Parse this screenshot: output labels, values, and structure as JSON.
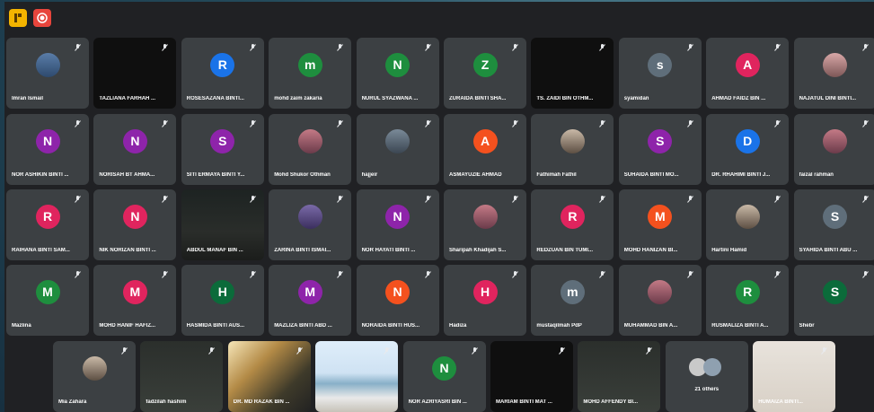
{
  "colors": {
    "red": "#e0245e",
    "green": "#1e8e3e",
    "purple": "#8e24aa",
    "blue": "#1a73e8",
    "orange": "#f4511e",
    "teal": "#5f6368",
    "darkgreen": "#0b6b3a",
    "slate": "#5f6e7a"
  },
  "toolbar": {
    "left_icon": "layout-icon",
    "right_icon": "record-icon"
  },
  "rows": [
    [
      {
        "name": "Imran Ismail",
        "type": "photo"
      },
      {
        "name": "TAZLIANA FARHAH ...",
        "type": "dark"
      },
      {
        "name": "ROSESAZANA BINTI...",
        "type": "avatar",
        "initial": "R",
        "color": "#1a73e8"
      },
      {
        "name": "mohd zaim zakaria",
        "type": "avatar",
        "initial": "m",
        "color": "#1e8e3e"
      },
      {
        "name": "NURUL SYAZWANA ...",
        "type": "avatar",
        "initial": "N",
        "color": "#1e8e3e"
      },
      {
        "name": "ZURAIDA BINTI SHA...",
        "type": "avatar",
        "initial": "Z",
        "color": "#1e8e3e"
      },
      {
        "name": "TS. ZAIDI BIN OTHM...",
        "type": "dark"
      },
      {
        "name": "syamidan",
        "type": "avatar",
        "initial": "s",
        "color": "#5f6e7a"
      },
      {
        "name": "AHMAD FAIDZ BIN ...",
        "type": "avatar",
        "initial": "A",
        "color": "#e0245e"
      },
      {
        "name": "NAJATUL DINI BINTI...",
        "type": "photo"
      }
    ],
    [
      {
        "name": "NOR ASHIKIN BINTI ...",
        "type": "avatar",
        "initial": "N",
        "color": "#8e24aa"
      },
      {
        "name": "NORISAH BT AHMA...",
        "type": "avatar",
        "initial": "N",
        "color": "#8e24aa"
      },
      {
        "name": "SITI ERMAYA BINTI Y...",
        "type": "avatar",
        "initial": "S",
        "color": "#8e24aa"
      },
      {
        "name": "Mohd Shukor Othman",
        "type": "photo"
      },
      {
        "name": "hajjeir",
        "type": "photo"
      },
      {
        "name": "ASMAYUZIE AHMAD",
        "type": "avatar",
        "initial": "A",
        "color": "#f4511e"
      },
      {
        "name": "Fathimah Fathil",
        "type": "photo"
      },
      {
        "name": "SUHAIDA BINTI MO...",
        "type": "avatar",
        "initial": "S",
        "color": "#8e24aa"
      },
      {
        "name": "DR. RHAHIMI BINTI J...",
        "type": "avatar",
        "initial": "D",
        "color": "#1a73e8"
      },
      {
        "name": "faizal rahman",
        "type": "photo"
      }
    ],
    [
      {
        "name": "RAIHANA BINTI SAM...",
        "type": "avatar",
        "initial": "R",
        "color": "#e0245e"
      },
      {
        "name": "NIK NORIZAN BINTI ...",
        "type": "avatar",
        "initial": "N",
        "color": "#e0245e"
      },
      {
        "name": "ABDUL MANAF BIN ...",
        "type": "video1"
      },
      {
        "name": "ZARINA BINTI ISMAI...",
        "type": "photo"
      },
      {
        "name": "NOR HAYATI BINTI ...",
        "type": "avatar",
        "initial": "N",
        "color": "#8e24aa"
      },
      {
        "name": "Sharipah Khadijah S...",
        "type": "photo"
      },
      {
        "name": "REDZUAN BIN TUMI...",
        "type": "avatar",
        "initial": "R",
        "color": "#e0245e"
      },
      {
        "name": "MOHD HANIZAN BI...",
        "type": "avatar",
        "initial": "M",
        "color": "#f4511e"
      },
      {
        "name": "Hartini Hamid",
        "type": "photo"
      },
      {
        "name": "SYAHIDA BINTI ABU ...",
        "type": "avatar",
        "initial": "S",
        "color": "#5f6e7a"
      }
    ],
    [
      {
        "name": "Mazlina",
        "type": "avatar",
        "initial": "M",
        "color": "#1e8e3e"
      },
      {
        "name": "MOHD HANIF HAFIZ...",
        "type": "avatar",
        "initial": "M",
        "color": "#e0245e"
      },
      {
        "name": "HASMIDA BINTI AUS...",
        "type": "avatar",
        "initial": "H",
        "color": "#0b6b3a"
      },
      {
        "name": "MAZLIZA BINTI ABD ...",
        "type": "avatar",
        "initial": "M",
        "color": "#8e24aa"
      },
      {
        "name": "NORAIDA BINTI HUS...",
        "type": "avatar",
        "initial": "N",
        "color": "#f4511e"
      },
      {
        "name": "Hadiza",
        "type": "avatar",
        "initial": "H",
        "color": "#e0245e"
      },
      {
        "name": "mustaqilmah PdP",
        "type": "avatar",
        "initial": "m",
        "color": "#5f6e7a"
      },
      {
        "name": "MUHAMMAD BIN A...",
        "type": "photo"
      },
      {
        "name": "RUSMALIZA BINTI A...",
        "type": "avatar",
        "initial": "R",
        "color": "#1e8e3e"
      },
      {
        "name": "Shebr",
        "type": "avatar",
        "initial": "S",
        "color": "#0b6b3a"
      }
    ],
    [
      {
        "name": "Mia Zahara",
        "type": "photo"
      },
      {
        "name": "fadzilah hashim",
        "type": "video5"
      },
      {
        "name": "DR. MD RAZAK BIN ...",
        "type": "video2"
      },
      {
        "name": "",
        "type": "video3"
      },
      {
        "name": "NOR AZRIYASRI BIN ...",
        "type": "avatar",
        "initial": "N",
        "color": "#1e8e3e"
      },
      {
        "name": "MARIAM BINTI MAT ...",
        "type": "dark"
      },
      {
        "name": "MOHD AFFENDY BI...",
        "type": "video5"
      },
      {
        "name": "21 others",
        "type": "others"
      },
      {
        "name": "HUMAIZA BINTI...",
        "type": "video4"
      }
    ]
  ]
}
